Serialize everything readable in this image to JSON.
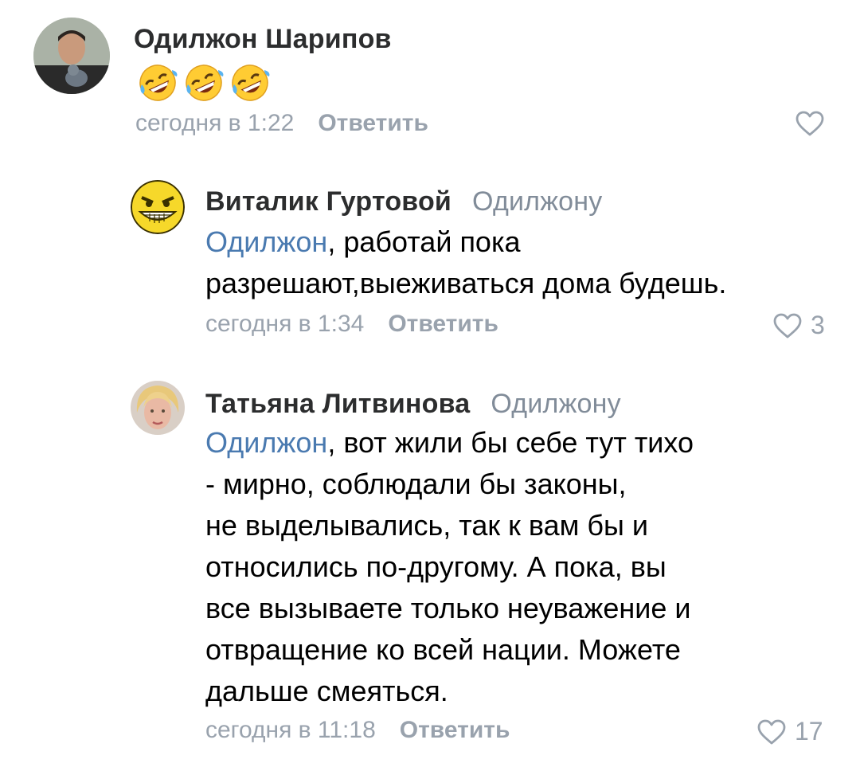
{
  "comments": [
    {
      "author": "Одилжон Шарипов",
      "reply_to": "",
      "emoji": [
        "rofl-emoji",
        "rofl-emoji",
        "rofl-emoji"
      ],
      "time": "сегодня в 1:22",
      "reply_label": "Ответить",
      "likes": ""
    },
    {
      "author": "Виталик Гуртовой",
      "reply_to": "Одилжону",
      "mention": "Одилжон",
      "text": ", работай пока\nразрешают,выеживаться дома будешь.",
      "time": "сегодня в 1:34",
      "reply_label": "Ответить",
      "likes": "3"
    },
    {
      "author": "Татьяна Литвинова",
      "reply_to": "Одилжону",
      "mention": "Одилжон",
      "text": ", вот жили бы себе тут тихо\n- мирно, соблюдали бы законы,\nне выделывались, так к вам бы и\nотносились по-другому. А пока, вы\nвсе вызываете только неуважение и\nотвращение ко всей нации. Можете\nдальше смеяться.",
      "time": "сегодня в 11:18",
      "reply_label": "Ответить",
      "likes": "17"
    }
  ],
  "colors": {
    "author": "#2c2d2e",
    "secondary": "#818c99",
    "meta": "#99a2ad",
    "mention": "#4a7ab0"
  }
}
